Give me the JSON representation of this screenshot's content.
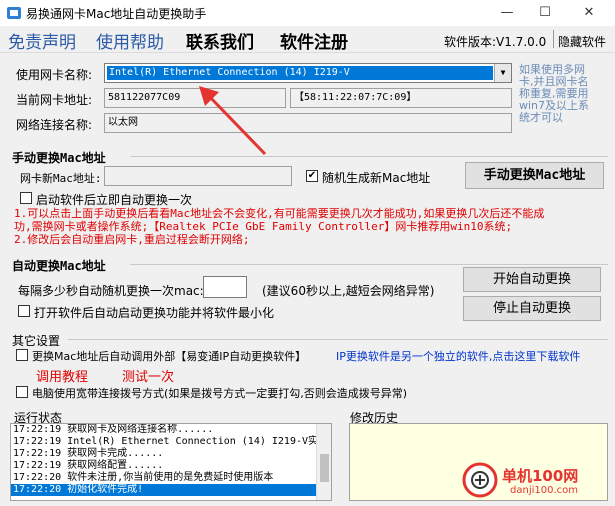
{
  "window": {
    "title": "易换通网卡Mac地址自动更换助手",
    "minimize": "—",
    "maximize": "☐",
    "close": "✕"
  },
  "menu": {
    "items": [
      "免责声明",
      "使用帮助",
      "联系我们",
      "软件注册"
    ],
    "version": "软件版本:V1.7.0.0",
    "hide": "隐藏软件"
  },
  "adapter": {
    "label_name": "使用网卡名称:",
    "selected": "Intel(R) Ethernet Connection (14) I219-V",
    "label_mac": "当前网卡地址:",
    "mac_value": "581122077C09",
    "mac_formatted": "【58:11:22:07:7C:09】",
    "label_conn": "网络连接名称:",
    "conn_value": "以太网",
    "hint_lines": [
      "如果使用多网",
      "卡,并且网卡名",
      "称重复,需要用",
      "win7及以上系",
      "统才可以"
    ]
  },
  "manual": {
    "title": "手动更换Mac地址",
    "label_new": "网卡新Mac地址:",
    "new_value": "",
    "random_label": "随机生成新Mac地址",
    "random_checked": "✔",
    "button": "手动更换Mac地址",
    "startup_label": "启动软件后立即自动更换一次",
    "notes": [
      "1.可以点击上面手动更换后看看Mac地址会不会变化,有可能需要更换几次才能成功,如果更换几次后还不能成",
      "  功,需换网卡或者操作系统;【Realtek PCIe GbE Family Controller】网卡推荐用win10系统;",
      "2.修改后会自动重启网卡,重启过程会断开网络;"
    ]
  },
  "auto": {
    "title": "自动更换Mac地址",
    "interval_label": "每隔多少秒自动随机更换一次mac:",
    "interval_value": "",
    "interval_hint": "(建议60秒以上,越短会网络异常)",
    "start_button": "开始自动更换",
    "stop_button": "停止自动更换",
    "minimize_label": "打开软件后自动启动更换功能并将软件最小化"
  },
  "other": {
    "title": "其它设置",
    "ipchange_label": "更换Mac地址后自动调用外部【易变通IP自动更换软件】",
    "ipchange_link": "IP更换软件是另一个独立的软件,点击这里下载软件",
    "tutorial": "调用教程",
    "test": "测试一次",
    "dialup_label": "电脑使用宽带连接拨号方式(如果是拨号方式一定要打勾,否则会造成拨号异常)"
  },
  "log": {
    "title": "运行状态",
    "lines": [
      "17:22:19 获取网卡及网络连接名称......",
      "17:22:19 Intel(R) Ethernet Connection (14) I219-V实",
      "17:22:19 获取网卡完成......",
      "17:22:19 获取网络配置......",
      "17:22:20 软件未注册,你当前使用的是免费延时使用版本",
      "17:22:20 初始化软件完成!"
    ]
  },
  "history": {
    "title": "修改历史"
  },
  "watermark": {
    "brand": "单机100网",
    "url": "danji100.com"
  },
  "colors": {
    "accent": "#0078d7",
    "arrow": "#e3342f",
    "red_text": "#e00000",
    "link_blue": "#0033cc"
  }
}
